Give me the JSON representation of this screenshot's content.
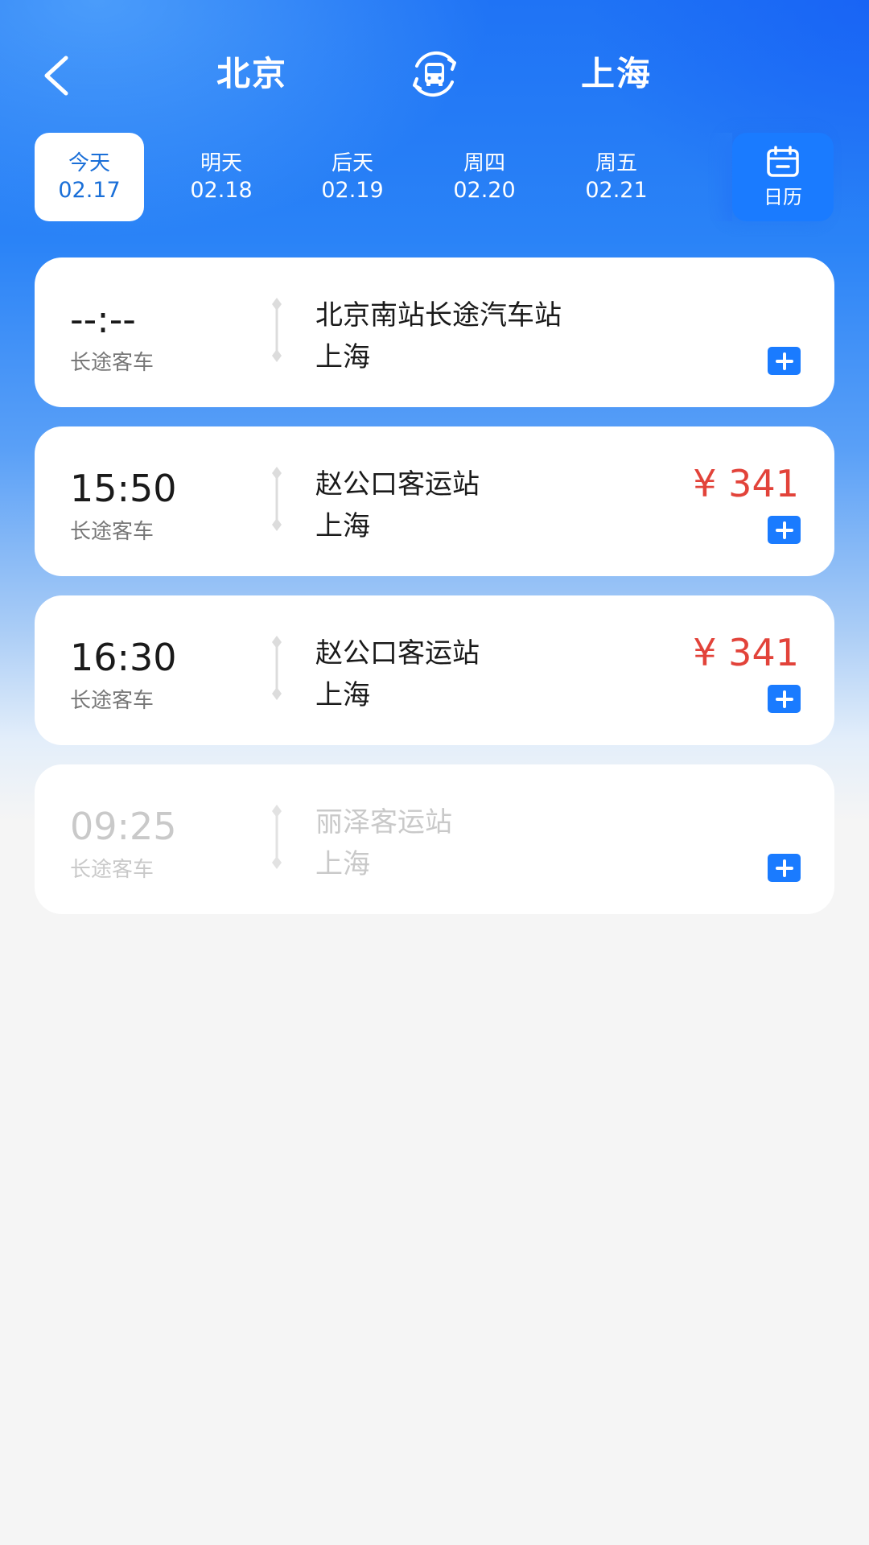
{
  "header": {
    "from_city": "北京",
    "to_city": "上海"
  },
  "dates": [
    {
      "day": "今天",
      "date": "02.17",
      "active": true
    },
    {
      "day": "明天",
      "date": "02.18",
      "active": false
    },
    {
      "day": "后天",
      "date": "02.19",
      "active": false
    },
    {
      "day": "周四",
      "date": "02.20",
      "active": false
    },
    {
      "day": "周五",
      "date": "02.21",
      "active": false
    }
  ],
  "calendar": {
    "label": "日历",
    "icon": "calendar-icon"
  },
  "tickets": [
    {
      "time": "--:--",
      "type": "长途客车",
      "from_station": "北京南站长途汽车站",
      "to_station": "上海",
      "price": "",
      "disabled": false
    },
    {
      "time": "15:50",
      "type": "长途客车",
      "from_station": "赵公口客运站",
      "to_station": "上海",
      "price": "¥ 341",
      "disabled": false
    },
    {
      "time": "16:30",
      "type": "长途客车",
      "from_station": "赵公口客运站",
      "to_station": "上海",
      "price": "¥ 341",
      "disabled": false
    },
    {
      "time": "09:25",
      "type": "长途客车",
      "from_station": "丽泽客运站",
      "to_station": "上海",
      "price": "",
      "disabled": true
    }
  ],
  "colors": {
    "accent": "#1a7bff",
    "price": "#e2433a",
    "active_tab_text": "#1a6fd8"
  }
}
